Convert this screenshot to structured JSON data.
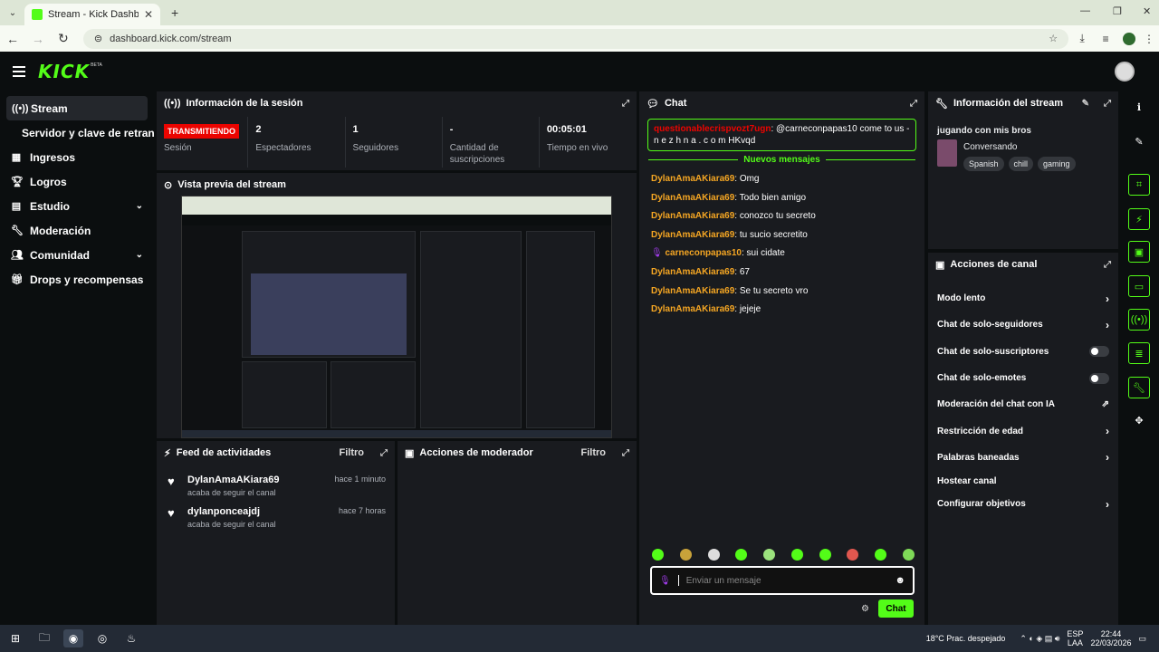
{
  "browser": {
    "tab_title": "Stream - Kick Dashboard",
    "url": "dashboard.kick.com/stream"
  },
  "brand": {
    "logo": "KICK",
    "badge": "BETA",
    "accent": "#53fc18"
  },
  "sidebar": {
    "items": [
      {
        "label": "Stream",
        "icon": "broadcast-icon"
      },
      {
        "label": "Servidor y clave de retransmisión"
      },
      {
        "label": "Ingresos",
        "icon": "chart-icon"
      },
      {
        "label": "Logros",
        "icon": "trophy-icon"
      },
      {
        "label": "Estudio",
        "icon": "studio-icon"
      },
      {
        "label": "Moderación",
        "icon": "wrench-icon"
      },
      {
        "label": "Comunidad",
        "icon": "community-icon"
      },
      {
        "label": "Drops y recompensas",
        "icon": "gift-icon"
      }
    ]
  },
  "session": {
    "title": "Información de la sesión",
    "status": "TRANSMITIENDO",
    "status_label": "Sesión",
    "stats": [
      {
        "value": "2",
        "label": "Espectadores"
      },
      {
        "value": "1",
        "label": "Seguidores"
      },
      {
        "value": "-",
        "label": "Cantidad de suscripciones"
      },
      {
        "value": "00:05:01",
        "label": "Tiempo en vivo"
      }
    ]
  },
  "preview": {
    "title": "Vista previa del stream"
  },
  "feed": {
    "title": "Feed de actividades",
    "filter": "Filtro",
    "items": [
      {
        "name": "DylanAmaAKiara69",
        "action": "acaba de seguir el canal",
        "time": "hace 1 minuto"
      },
      {
        "name": "dylanponceajdj",
        "action": "acaba de seguir el canal",
        "time": "hace 7 horas"
      }
    ]
  },
  "modactions": {
    "title": "Acciones de moderador",
    "filter": "Filtro"
  },
  "chat": {
    "title": "Chat",
    "pinned_user": "questionablecrispvozt7ugn",
    "pinned_text": ": @carneconpapas10 come to us - n e z h n a . c o m HKvqd",
    "new_messages": "Nuevos mensajes",
    "messages": [
      {
        "user": "DylanAmaAKiara69",
        "text": ": Omg"
      },
      {
        "user": "DylanAmaAKiara69",
        "text": ": Todo bien amigo"
      },
      {
        "user": "DylanAmaAKiara69",
        "text": ": conozco tu secreto"
      },
      {
        "user": "DylanAmaAKiara69",
        "text": ": tu sucio secretito"
      },
      {
        "user": "carneconpapas10",
        "text": ": sui cidate"
      },
      {
        "user": "DylanAmaAKiara69",
        "text": ": 67"
      },
      {
        "user": "DylanAmaAKiara69",
        "text": ": Se tu secreto vro"
      },
      {
        "user": "DylanAmaAKiara69",
        "text": ": jejeje"
      }
    ],
    "input_placeholder": "Enviar un mensaje",
    "send_label": "Chat"
  },
  "stream_info": {
    "title": "Información del stream",
    "stream_title": "jugando con mis bros",
    "category": "Conversando",
    "tags": [
      "Spanish",
      "chill",
      "gaming"
    ]
  },
  "channel_actions": {
    "title": "Acciones de canal",
    "items": [
      {
        "label": "Modo lento",
        "control": "arrow"
      },
      {
        "label": "Chat de solo-seguidores",
        "control": "arrow"
      },
      {
        "label": "Chat de solo-suscriptores",
        "control": "toggle",
        "on": false
      },
      {
        "label": "Chat de solo-emotes",
        "control": "toggle",
        "on": false
      },
      {
        "label": "Moderación del chat con IA",
        "control": "external"
      },
      {
        "label": "Restricción de edad",
        "control": "arrow"
      },
      {
        "label": "Palabras baneadas",
        "control": "arrow"
      },
      {
        "label": "Hostear canal",
        "control": "none"
      },
      {
        "label": "Configurar objetivos",
        "control": "arrow"
      }
    ]
  },
  "taskbar": {
    "weather": "18°C  Prac. despejado",
    "lang": "ESP",
    "lang2": "LAA",
    "time": "22:44",
    "date": "22/03/2026"
  }
}
